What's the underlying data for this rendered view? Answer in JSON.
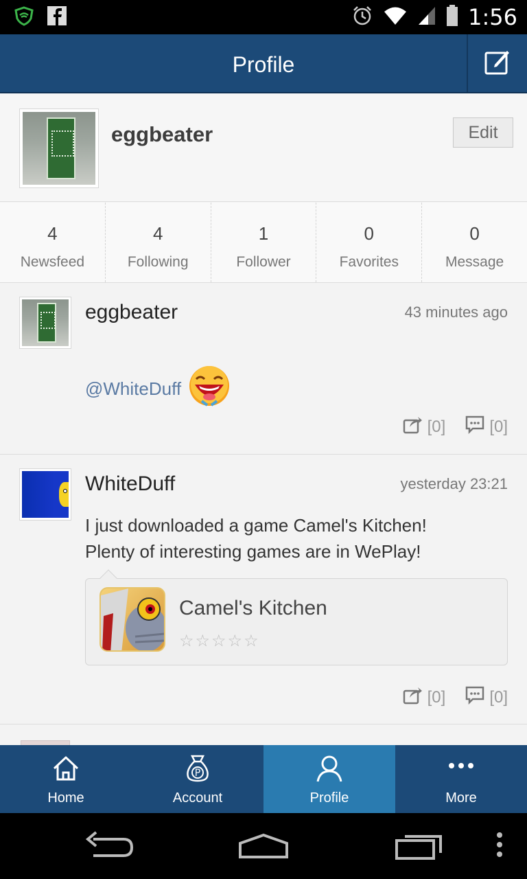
{
  "status_bar": {
    "time": "1:56",
    "icons": [
      "shield-icon",
      "facebook-icon",
      "alarm-icon",
      "wifi-icon",
      "signal-icon",
      "battery-icon"
    ]
  },
  "app_bar": {
    "title": "Profile",
    "compose_icon": "compose-icon"
  },
  "profile": {
    "username": "eggbeater",
    "edit_label": "Edit"
  },
  "stats": [
    {
      "value": "4",
      "label": "Newsfeed"
    },
    {
      "value": "4",
      "label": "Following"
    },
    {
      "value": "1",
      "label": "Follower"
    },
    {
      "value": "0",
      "label": "Favorites"
    },
    {
      "value": "0",
      "label": "Message"
    }
  ],
  "posts": [
    {
      "author": "eggbeater",
      "time": "43 minutes ago",
      "mention": "@WhiteDuff",
      "share_count": "[0]",
      "comment_count": "[0]"
    },
    {
      "author": "WhiteDuff",
      "time": "yesterday  23:21",
      "text_line1": "I just downloaded a game Camel's Kitchen!",
      "text_line2": "Plenty of interesting games are in WePlay!",
      "game_name": "Camel's Kitchen",
      "stars": "☆☆☆☆☆",
      "rating": 0,
      "share_count": "[0]",
      "comment_count": "[0]"
    }
  ],
  "bottom_nav": [
    {
      "label": "Home",
      "icon": "home-icon"
    },
    {
      "label": "Account",
      "icon": "money-bag-icon"
    },
    {
      "label": "Profile",
      "icon": "person-icon",
      "active": true
    },
    {
      "label": "More",
      "icon": "more-dots-icon"
    }
  ],
  "colors": {
    "primary": "#1c4a78",
    "active_tab": "#2a7bb0",
    "mention": "#5a7aa3"
  }
}
